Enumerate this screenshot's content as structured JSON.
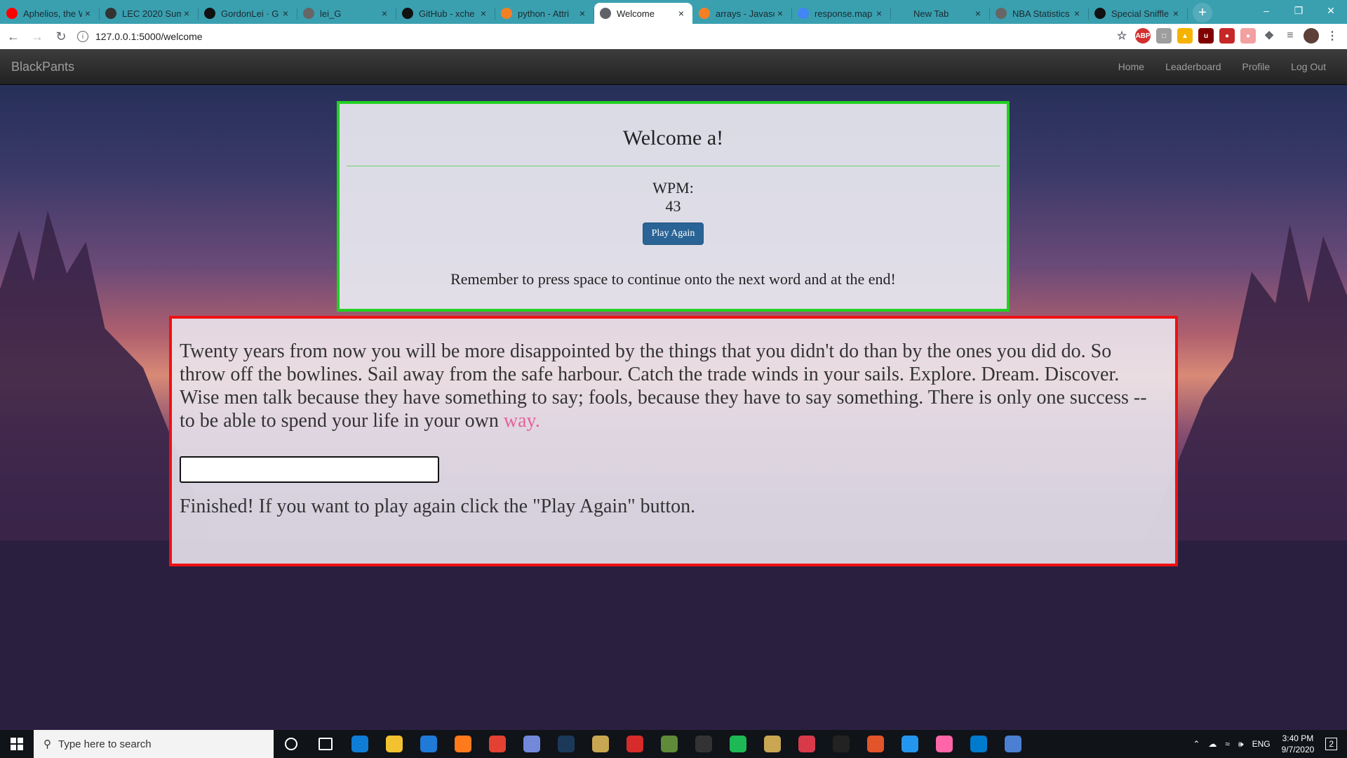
{
  "browser": {
    "tabs": [
      {
        "label": "Aphelios, the W",
        "icon": "youtube-icon",
        "color": "#ff0000"
      },
      {
        "label": "LEC 2020 Sum",
        "icon": "trophy-icon",
        "color": "#333333"
      },
      {
        "label": "GordonLei · G",
        "icon": "github-icon",
        "color": "#111111"
      },
      {
        "label": "lei_G",
        "icon": "globe-icon",
        "color": "#666666"
      },
      {
        "label": "GitHub - xche",
        "icon": "github-icon",
        "color": "#111111"
      },
      {
        "label": "python - Attri",
        "icon": "stackoverflow-icon",
        "color": "#f48024"
      },
      {
        "label": "Welcome",
        "icon": "globe-icon",
        "color": "#5f6368"
      },
      {
        "label": "arrays - Javasc",
        "icon": "stackoverflow-icon",
        "color": "#f48024"
      },
      {
        "label": "response.map",
        "icon": "google-icon",
        "color": "#4285f4"
      },
      {
        "label": "New Tab",
        "icon": "",
        "color": "#3aa0b0"
      },
      {
        "label": "NBA Statistics",
        "icon": "globe-icon",
        "color": "#666666"
      },
      {
        "label": "Special Sniffle",
        "icon": "github-icon",
        "color": "#111111"
      }
    ],
    "active_tab": 6,
    "url": "127.0.0.1:5000/welcome"
  },
  "site": {
    "brand": "BlackPants",
    "nav": [
      "Home",
      "Leaderboard",
      "Profile",
      "Log Out"
    ]
  },
  "result": {
    "welcome": "Welcome a!",
    "wpm_label": "WPM:",
    "wpm_value": "43",
    "play_again": "Play Again",
    "reminder": "Remember to press space to continue onto the next word and at the end!"
  },
  "game": {
    "quote_done": "Twenty years from now you will be more disappointed by the things that you didn't do than by the ones you did do. So throw off the bowlines. Sail away from the safe harbour. Catch the trade winds in your sails. Explore. Dream. Discover. Wise men talk because they have something to say; fools, because they have to say something. There is only one success -- to be able to spend your life in your own",
    "quote_current": "way.",
    "input_value": "",
    "finished": "Finished! If you want to play again click the \"Play Again\" button."
  },
  "taskbar": {
    "search_placeholder": "Type here to search",
    "apps": [
      {
        "icon": "cortana-icon",
        "color": "#101318"
      },
      {
        "icon": "task-view-icon",
        "color": "#101318"
      },
      {
        "icon": "edge-icon",
        "color": "#0f7dd6"
      },
      {
        "icon": "file-explorer-icon",
        "color": "#f2c230"
      },
      {
        "icon": "mail-icon",
        "color": "#1f7ad8"
      },
      {
        "icon": "firefox-icon",
        "color": "#ff7a1a"
      },
      {
        "icon": "chrome-icon",
        "color": "#e34133"
      },
      {
        "icon": "discord-icon",
        "color": "#7289da"
      },
      {
        "icon": "steam-icon",
        "color": "#1b3a5a"
      },
      {
        "icon": "league-icon",
        "color": "#c8a652"
      },
      {
        "icon": "adobe-icon",
        "color": "#d72a2a"
      },
      {
        "icon": "minecraft-icon",
        "color": "#5f8a3a"
      },
      {
        "icon": "riot-icon",
        "color": "#333333"
      },
      {
        "icon": "spotify-icon",
        "color": "#1db954"
      },
      {
        "icon": "league-client-icon",
        "color": "#c8a652"
      },
      {
        "icon": "valorant-icon",
        "color": "#d83a4a"
      },
      {
        "icon": "terminal-icon",
        "color": "#222222"
      },
      {
        "icon": "pen-icon",
        "color": "#e2552b"
      },
      {
        "icon": "docker-icon",
        "color": "#2496ed"
      },
      {
        "icon": "osu-icon",
        "color": "#ff66aa"
      },
      {
        "icon": "vscode-icon",
        "color": "#007acc"
      },
      {
        "icon": "paint-icon",
        "color": "#4a7fd1"
      }
    ],
    "lang": "ENG",
    "time": "3:40 PM",
    "date": "9/7/2020",
    "notifications": "2"
  }
}
